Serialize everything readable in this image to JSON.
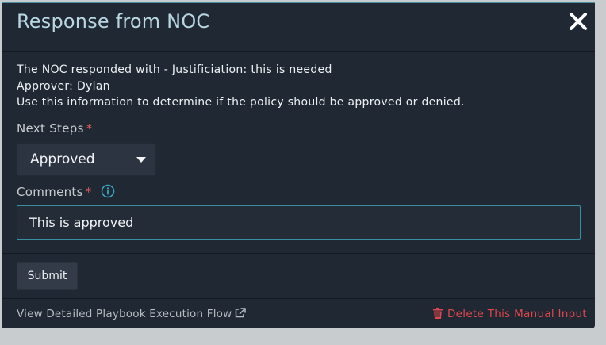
{
  "modal": {
    "title": "Response from NOC",
    "close_icon": "close-icon",
    "message_lines": [
      "The NOC responded with - Justificiation: this is needed",
      "Approver: Dylan",
      "Use this information to determine if the policy should be approved or denied."
    ]
  },
  "form": {
    "next_steps": {
      "label": "Next Steps",
      "required_marker": "*",
      "selected_value": "Approved",
      "caret_icon": "caret-down-icon"
    },
    "comments": {
      "label": "Comments",
      "required_marker": "*",
      "info_icon": "info-icon",
      "value": "This is approved"
    },
    "submit_label": "Submit"
  },
  "footer": {
    "view_flow_label": "View Detailed Playbook Execution Flow",
    "external_link_icon": "external-link-icon",
    "delete_label": "Delete This Manual Input",
    "trash_icon": "trash-icon"
  },
  "colors": {
    "modal_bg": "#1f2833",
    "accent": "#3a8ea3",
    "title": "#b9d6e3",
    "danger": "#e0474d",
    "required": "#e05a5a"
  }
}
